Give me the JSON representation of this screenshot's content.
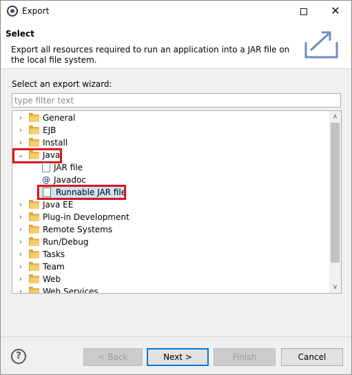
{
  "window": {
    "title": "Export"
  },
  "header": {
    "title": "Select",
    "description": "Export all resources required to run an application into a JAR file on the local file system."
  },
  "wizard": {
    "label": "Select an export wizard:",
    "filter_placeholder": "type filter text",
    "filter_value": ""
  },
  "tree": {
    "items": [
      {
        "label": "General",
        "expanded": false,
        "icon": "folder-icon"
      },
      {
        "label": "EJB",
        "expanded": false,
        "icon": "folder-icon"
      },
      {
        "label": "Install",
        "expanded": false,
        "icon": "folder-icon"
      },
      {
        "label": "Java",
        "expanded": true,
        "icon": "folder-open-icon",
        "highlighted": true
      },
      {
        "label": "JAR file",
        "icon": "jar-file-icon",
        "child": true
      },
      {
        "label": "Javadoc",
        "icon": "javadoc-icon",
        "child": true
      },
      {
        "label": "Runnable JAR file",
        "icon": "runnable-jar-icon",
        "child": true,
        "selected": true,
        "highlighted": true
      },
      {
        "label": "Java EE",
        "expanded": false,
        "icon": "folder-icon"
      },
      {
        "label": "Plug-in Development",
        "expanded": false,
        "icon": "folder-icon"
      },
      {
        "label": "Remote Systems",
        "expanded": false,
        "icon": "folder-icon"
      },
      {
        "label": "Run/Debug",
        "expanded": false,
        "icon": "folder-icon"
      },
      {
        "label": "Tasks",
        "expanded": false,
        "icon": "folder-icon"
      },
      {
        "label": "Team",
        "expanded": false,
        "icon": "folder-icon"
      },
      {
        "label": "Web",
        "expanded": false,
        "icon": "folder-icon"
      },
      {
        "label": "Web Services",
        "expanded": false,
        "icon": "folder-icon"
      }
    ]
  },
  "buttons": {
    "back": "< Back",
    "next": "Next >",
    "finish": "Finish",
    "cancel": "Cancel"
  },
  "colors": {
    "highlight": "#e0101c",
    "selection": "#cce4f7",
    "folder": "#e8b64c"
  }
}
